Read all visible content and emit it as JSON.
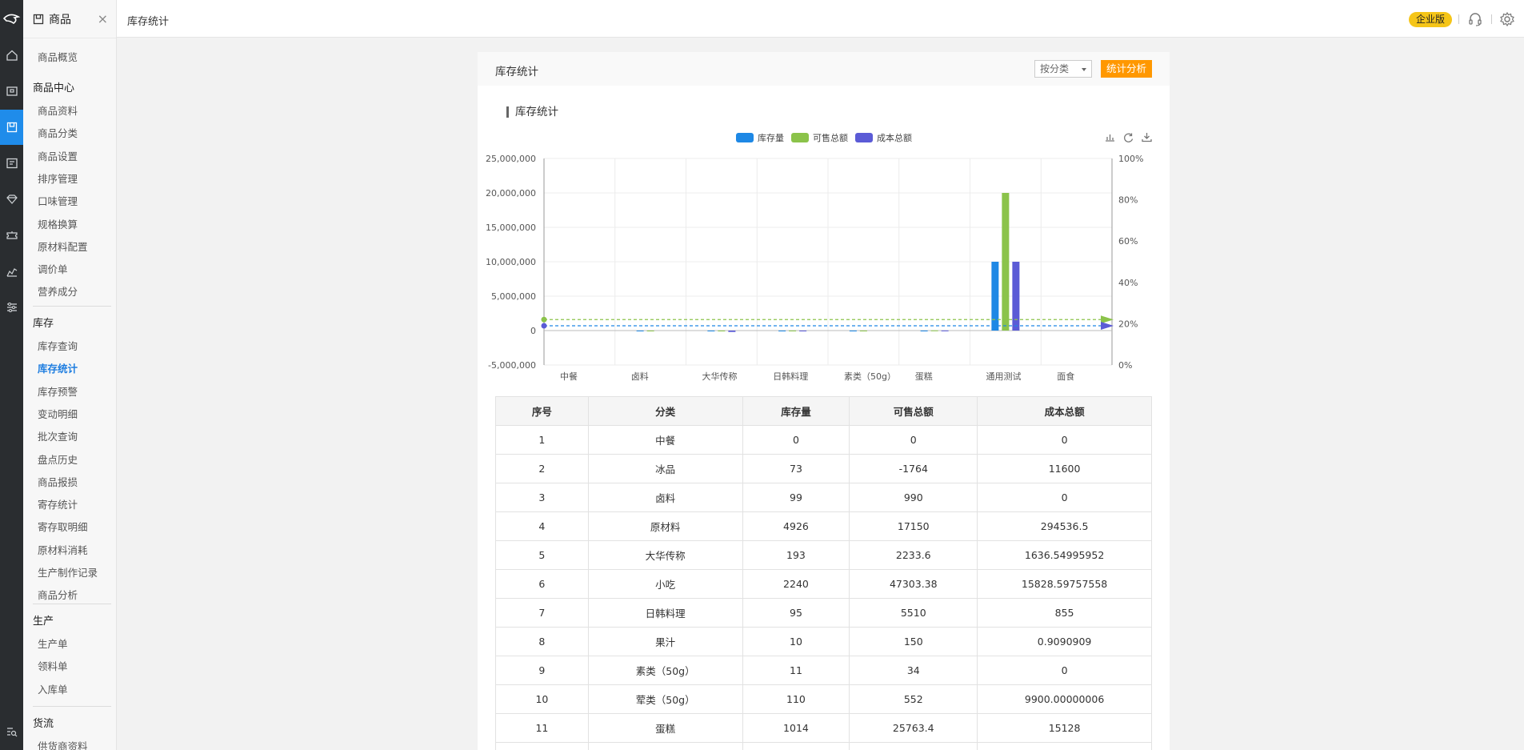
{
  "rail": {
    "items": [
      {
        "name": "home-icon"
      },
      {
        "name": "shop-icon"
      },
      {
        "name": "goods-icon",
        "active": true
      },
      {
        "name": "member-card-icon"
      },
      {
        "name": "diamond-icon"
      },
      {
        "name": "coupon-icon"
      },
      {
        "name": "report-chart-icon"
      },
      {
        "name": "settings-sliders-icon"
      },
      {
        "name": "search-list-icon"
      }
    ]
  },
  "sidebar": {
    "title": "商品",
    "close": "×",
    "overview": "商品概览",
    "sections": [
      {
        "title": "商品中心",
        "items": [
          "商品资料",
          "商品分类",
          "商品设置",
          "排序管理",
          "口味管理",
          "规格换算",
          "原材料配置",
          "调价单",
          "营养成分"
        ]
      },
      {
        "title": "库存",
        "items": [
          "库存查询",
          "库存统计",
          "库存预警",
          "变动明细",
          "批次查询",
          "盘点历史",
          "商品报损",
          "寄存统计",
          "寄存取明细",
          "原材料消耗",
          "生产制作记录",
          "商品分析"
        ]
      },
      {
        "title": "生产",
        "items": [
          "生产单",
          "领料单",
          "入库单"
        ]
      },
      {
        "title": "货流",
        "items": [
          "供货商资料"
        ]
      }
    ],
    "active_item": "库存统计"
  },
  "topbar": {
    "title": "库存统计",
    "badge": "企业版"
  },
  "card": {
    "title": "库存统计",
    "select_value": "按分类",
    "analyze_button": "统计分析",
    "section_title": "库存统计"
  },
  "colors": {
    "stock": "#1e88e5",
    "sale": "#8bc34a",
    "cost": "#5b5bd6",
    "accent": "#ff9800",
    "active_blue": "#1f8cea"
  },
  "chart_data": {
    "type": "bar",
    "legend": [
      "库存量",
      "可售总额",
      "成本总额"
    ],
    "categories": [
      "中餐",
      "卤料",
      "大华传称",
      "日韩料理",
      "素类（50g）",
      "蛋糕",
      "通用测试",
      "面食"
    ],
    "series": [
      {
        "name": "库存量",
        "values": [
          0,
          99,
          193,
          95,
          11,
          1014,
          10000000,
          0
        ]
      },
      {
        "name": "可售总额",
        "values": [
          0,
          990,
          2233.6,
          5510,
          34,
          25763.4,
          20000000,
          0
        ]
      },
      {
        "name": "成本总额",
        "values": [
          0,
          0,
          -200000,
          855,
          0,
          15128,
          10000000,
          0
        ]
      }
    ],
    "ylim": [
      -5000000,
      25000000
    ],
    "yticks": [
      "25,000,000",
      "20,000,000",
      "15,000,000",
      "10,000,000",
      "5,000,000",
      "0",
      "-5,000,000"
    ],
    "y2ticks": [
      "100%",
      "80%",
      "60%",
      "40%",
      "20%",
      "0%"
    ],
    "y2lim": [
      0,
      100
    ],
    "markline": {
      "sale": 22,
      "stock": 19
    },
    "toolbox": [
      "bar-chart-icon",
      "refresh-icon",
      "download-icon"
    ],
    "grid": true,
    "legend_position": "top-center"
  },
  "table": {
    "headers": [
      "序号",
      "分类",
      "库存量",
      "可售总额",
      "成本总额"
    ],
    "rows": [
      [
        "1",
        "中餐",
        "0",
        "0",
        "0"
      ],
      [
        "2",
        "冰品",
        "73",
        "-1764",
        "11600"
      ],
      [
        "3",
        "卤料",
        "99",
        "990",
        "0"
      ],
      [
        "4",
        "原材料",
        "4926",
        "17150",
        "294536.5"
      ],
      [
        "5",
        "大华传称",
        "193",
        "2233.6",
        "1636.54995952"
      ],
      [
        "6",
        "小吃",
        "2240",
        "47303.38",
        "15828.59757558"
      ],
      [
        "7",
        "日韩料理",
        "95",
        "5510",
        "855"
      ],
      [
        "8",
        "果汁",
        "10",
        "150",
        "0.9090909"
      ],
      [
        "9",
        "素类（50g）",
        "11",
        "34",
        "0"
      ],
      [
        "10",
        "荤类（50g）",
        "110",
        "552",
        "9900.00000006"
      ],
      [
        "11",
        "蛋糕",
        "1014",
        "25763.4",
        "15128"
      ],
      [
        "",
        "",
        "",
        "",
        ""
      ]
    ]
  }
}
